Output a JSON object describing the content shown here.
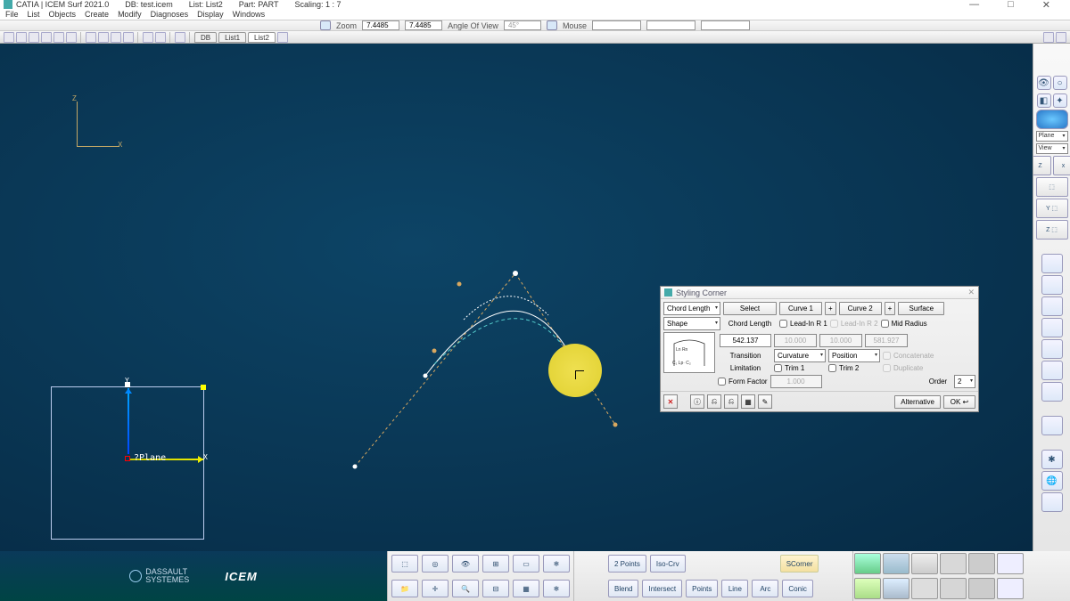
{
  "titlebar": {
    "app": "CATIA | ICEM Surf 2021.0",
    "db": "DB: test.icem",
    "list": "List: List2",
    "part": "Part: PART",
    "scaling": "Scaling: 1 : 7",
    "minimize": "—",
    "maximize": "□",
    "close": "✕"
  },
  "menu": {
    "file": "File",
    "list": "List",
    "objects": "Objects",
    "create": "Create",
    "modify": "Modify",
    "diagnoses": "Diagnoses",
    "display": "Display",
    "windows": "Windows"
  },
  "infobar": {
    "zoom_label": "Zoom",
    "zoom1": "7.4485",
    "zoom2": "7.4485",
    "angle_label": "Angle Of View",
    "angle": "45°",
    "mouse_label": "Mouse"
  },
  "toolbar_tabs": {
    "db": "DB",
    "l1": "List1",
    "l2": "List2"
  },
  "right": {
    "plane": "Plane",
    "view": "View",
    "z": "Z",
    "x": "x"
  },
  "plane": {
    "label": "?Plane",
    "ylbl": "Y",
    "xlbl": "X"
  },
  "axis": {
    "z": "Z",
    "x": "X"
  },
  "dialog": {
    "title": "Styling Corner",
    "chord_length": "Chord Length",
    "shape": "Shape",
    "select": "Select",
    "curve1": "Curve 1",
    "curve2": "Curve 2",
    "surface": "Surface",
    "plus": "+",
    "chord_length_lbl": "Chord Length",
    "lead_in_r1": "Lead-In R 1",
    "lead_in_r2": "Lead-In R 2",
    "mid_radius": "Mid Radius",
    "val_chord": "542.137",
    "val_r1": "10.000",
    "val_r2": "10.000",
    "val_mid": "581.927",
    "transition": "Transition",
    "curvature": "Curvature",
    "position": "Position",
    "concatenate": "Concatenate",
    "limitation": "Limitation",
    "trim1": "Trim 1",
    "trim2": "Trim 2",
    "duplicate": "Duplicate",
    "form_factor": "Form Factor",
    "val_form": "1.000",
    "order": "Order",
    "order_val": "2",
    "alternative": "Alternative",
    "ok": "OK  ↩",
    "cancel": "✕",
    "thumb": "Ln Rn\nC₁ Lp C₂"
  },
  "bottom_labels": {
    "ds": "DASSAULT\nSYSTEMES",
    "icem": "ICEM",
    "two_points": "2 Points",
    "iso_crv": "Iso-Crv",
    "scorner": "SCorner",
    "blend": "Blend",
    "intersect": "Intersect",
    "points": "Points",
    "line": "Line",
    "arc": "Arc",
    "conic": "Conic"
  }
}
